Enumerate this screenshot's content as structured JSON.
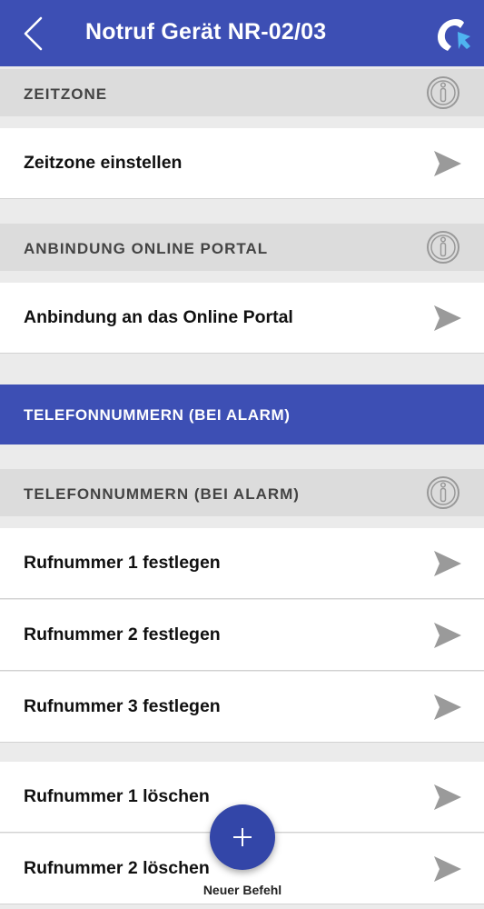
{
  "header": {
    "title": "Notruf Gerät NR-02/03",
    "back_icon": "chevron-left-icon",
    "call_icon": "phone-callback-icon"
  },
  "colors": {
    "primary": "#3d4fb4",
    "section_bg": "#dcdcdc",
    "page_bg": "#ebebeb",
    "send_icon": "#9a9a9a"
  },
  "sections": {
    "zeitzone": {
      "title": "ZEITZONE",
      "rows": [
        "Zeitzone einstellen"
      ]
    },
    "online_portal": {
      "title": "ANBINDUNG ONLINE PORTAL",
      "rows": [
        "Anbindung an das Online Portal"
      ]
    },
    "telefon_band": {
      "title": "TELEFONNUMMERN (BEI ALARM)"
    },
    "telefon": {
      "title": "TELEFONNUMMERN (BEI ALARM)",
      "rows": [
        "Rufnummer 1 festlegen",
        "Rufnummer 2 festlegen",
        "Rufnummer 3 festlegen"
      ]
    },
    "loeschen": {
      "rows": [
        "Rufnummer 1 löschen",
        "Rufnummer 2 löschen"
      ]
    }
  },
  "fab": {
    "label": "Neuer Befehl",
    "icon": "plus-icon"
  }
}
